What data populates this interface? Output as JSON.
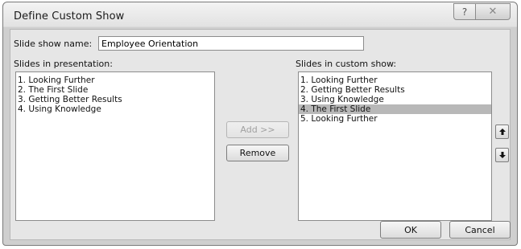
{
  "window": {
    "title": "Define Custom Show",
    "help_glyph": "?",
    "close_glyph": "✕"
  },
  "name_field": {
    "label": "Slide show name:",
    "value": "Employee Orientation"
  },
  "left_list": {
    "label": "Slides in presentation:",
    "items": [
      "1. Looking Further",
      "2. The First Slide",
      "3. Getting Better Results",
      "4. Using Knowledge"
    ]
  },
  "right_list": {
    "label": "Slides in custom show:",
    "items": [
      "1. Looking Further",
      "2. Getting Better Results",
      "3. Using Knowledge",
      "4. The First Slide",
      "5. Looking Further"
    ],
    "selected_index": 3
  },
  "buttons": {
    "add": "Add >>",
    "remove": "Remove",
    "ok": "OK",
    "cancel": "Cancel"
  },
  "icons": {
    "move_up": "arrow-up-icon",
    "move_down": "arrow-down-icon"
  }
}
